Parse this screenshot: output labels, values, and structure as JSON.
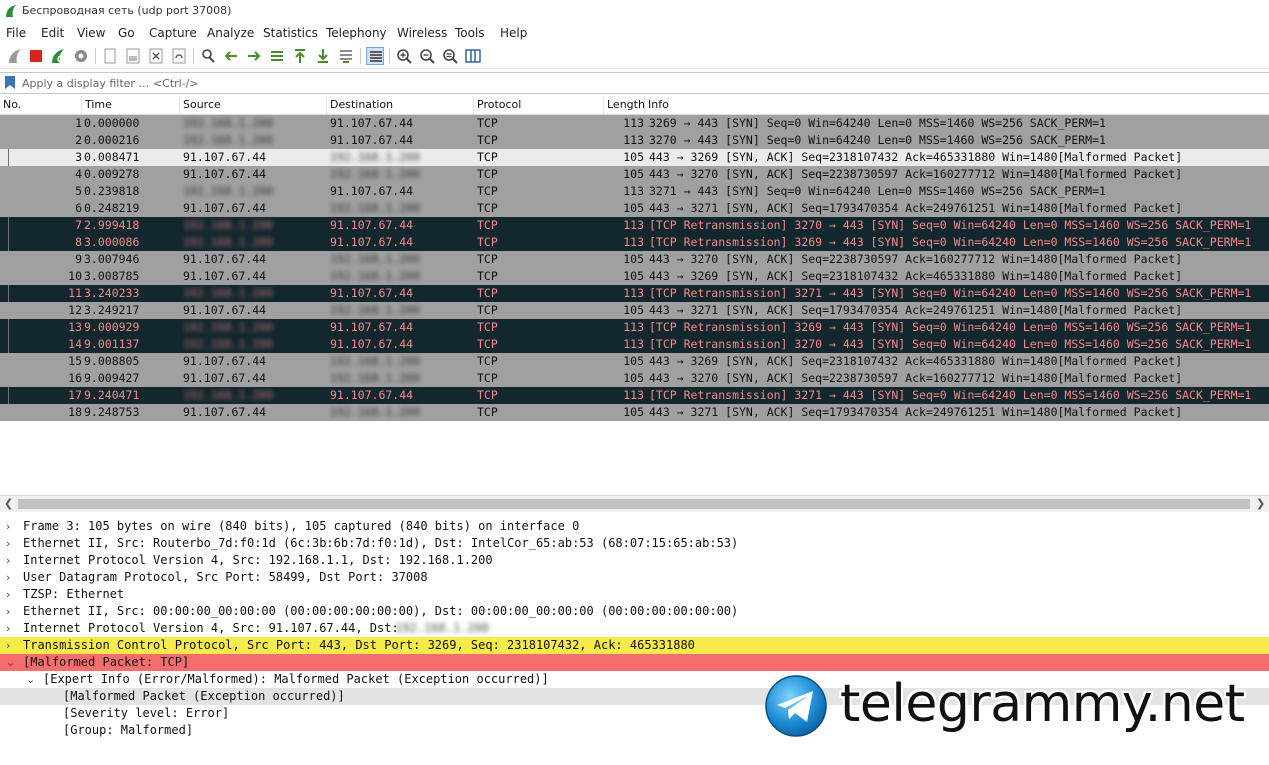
{
  "window": {
    "title": "Беспроводная сеть (udp port 37008)"
  },
  "menu": [
    "File",
    "Edit",
    "View",
    "Go",
    "Capture",
    "Analyze",
    "Statistics",
    "Telephony",
    "Wireless",
    "Tools",
    "Help"
  ],
  "filter": {
    "placeholder": "Apply a display filter … <Ctrl-/>"
  },
  "columns": [
    "No.",
    "Time",
    "Source",
    "Destination",
    "Protocol",
    "Length",
    "Info"
  ],
  "colors": {
    "dark_row": "#12272e",
    "dark_row_text": "#f78a8a",
    "gray_row": "#a0a0a0",
    "tcp_highlight": "#f6eb4a",
    "malformed_highlight": "#f76d6d"
  },
  "packets": [
    {
      "no": "1",
      "time": "0.000000",
      "src": "192.168.1.200",
      "dst": "91.107.67.44",
      "proto": "TCP",
      "len": "113",
      "info": "3269 → 443 [SYN] Seq=0 Win=64240 Len=0 MSS=1460 WS=256 SACK_PERM=1",
      "style": "g"
    },
    {
      "no": "2",
      "time": "0.000216",
      "src": "192.168.1.200",
      "dst": "91.107.67.44",
      "proto": "TCP",
      "len": "113",
      "info": "3270 → 443 [SYN] Seq=0 Win=64240 Len=0 MSS=1460 WS=256 SACK_PERM=1",
      "style": "g"
    },
    {
      "no": "3",
      "time": "0.008471",
      "src": "91.107.67.44",
      "dst": "192.168.1.200",
      "proto": "TCP",
      "len": "105",
      "info": "443 → 3269 [SYN, ACK] Seq=2318107432 Ack=465331880 Win=1480[Malformed Packet]",
      "style": "s"
    },
    {
      "no": "4",
      "time": "0.009278",
      "src": "91.107.67.44",
      "dst": "192.168.1.200",
      "proto": "TCP",
      "len": "105",
      "info": "443 → 3270 [SYN, ACK] Seq=2238730597 Ack=160277712 Win=1480[Malformed Packet]",
      "style": "g"
    },
    {
      "no": "5",
      "time": "0.239818",
      "src": "192.168.1.200",
      "dst": "91.107.67.44",
      "proto": "TCP",
      "len": "113",
      "info": "3271 → 443 [SYN] Seq=0 Win=64240 Len=0 MSS=1460 WS=256 SACK_PERM=1",
      "style": "g"
    },
    {
      "no": "6",
      "time": "0.248219",
      "src": "91.107.67.44",
      "dst": "192.168.1.200",
      "proto": "TCP",
      "len": "105",
      "info": "443 → 3271 [SYN, ACK] Seq=1793470354 Ack=249761251 Win=1480[Malformed Packet]",
      "style": "g"
    },
    {
      "no": "7",
      "time": "2.999418",
      "src": "192.168.1.200",
      "dst": "91.107.67.44",
      "proto": "TCP",
      "len": "113",
      "info": "[TCP Retransmission] 3270 → 443 [SYN] Seq=0 Win=64240 Len=0 MSS=1460 WS=256 SACK_PERM=1",
      "style": "d"
    },
    {
      "no": "8",
      "time": "3.000086",
      "src": "192.168.1.200",
      "dst": "91.107.67.44",
      "proto": "TCP",
      "len": "113",
      "info": "[TCP Retransmission] 3269 → 443 [SYN] Seq=0 Win=64240 Len=0 MSS=1460 WS=256 SACK_PERM=1",
      "style": "d"
    },
    {
      "no": "9",
      "time": "3.007946",
      "src": "91.107.67.44",
      "dst": "192.168.1.200",
      "proto": "TCP",
      "len": "105",
      "info": "443 → 3270 [SYN, ACK] Seq=2238730597 Ack=160277712 Win=1480[Malformed Packet]",
      "style": "g"
    },
    {
      "no": "10",
      "time": "3.008785",
      "src": "91.107.67.44",
      "dst": "192.168.1.200",
      "proto": "TCP",
      "len": "105",
      "info": "443 → 3269 [SYN, ACK] Seq=2318107432 Ack=465331880 Win=1480[Malformed Packet]",
      "style": "g"
    },
    {
      "no": "11",
      "time": "3.240233",
      "src": "192.168.1.200",
      "dst": "91.107.67.44",
      "proto": "TCP",
      "len": "113",
      "info": "[TCP Retransmission] 3271 → 443 [SYN] Seq=0 Win=64240 Len=0 MSS=1460 WS=256 SACK_PERM=1",
      "style": "d"
    },
    {
      "no": "12",
      "time": "3.249217",
      "src": "91.107.67.44",
      "dst": "192.168.1.200",
      "proto": "TCP",
      "len": "105",
      "info": "443 → 3271 [SYN, ACK] Seq=1793470354 Ack=249761251 Win=1480[Malformed Packet]",
      "style": "g"
    },
    {
      "no": "13",
      "time": "9.000929",
      "src": "192.168.1.200",
      "dst": "91.107.67.44",
      "proto": "TCP",
      "len": "113",
      "info": "[TCP Retransmission] 3269 → 443 [SYN] Seq=0 Win=64240 Len=0 MSS=1460 WS=256 SACK_PERM=1",
      "style": "d"
    },
    {
      "no": "14",
      "time": "9.001137",
      "src": "192.168.1.200",
      "dst": "91.107.67.44",
      "proto": "TCP",
      "len": "113",
      "info": "[TCP Retransmission] 3270 → 443 [SYN] Seq=0 Win=64240 Len=0 MSS=1460 WS=256 SACK_PERM=1",
      "style": "d"
    },
    {
      "no": "15",
      "time": "9.008805",
      "src": "91.107.67.44",
      "dst": "192.168.1.200",
      "proto": "TCP",
      "len": "105",
      "info": "443 → 3269 [SYN, ACK] Seq=2318107432 Ack=465331880 Win=1480[Malformed Packet]",
      "style": "g"
    },
    {
      "no": "16",
      "time": "9.009427",
      "src": "91.107.67.44",
      "dst": "192.168.1.200",
      "proto": "TCP",
      "len": "105",
      "info": "443 → 3270 [SYN, ACK] Seq=2238730597 Ack=160277712 Win=1480[Malformed Packet]",
      "style": "g"
    },
    {
      "no": "17",
      "time": "9.240471",
      "src": "192.168.1.200",
      "dst": "91.107.67.44",
      "proto": "TCP",
      "len": "113",
      "info": "[TCP Retransmission] 3271 → 443 [SYN] Seq=0 Win=64240 Len=0 MSS=1460 WS=256 SACK_PERM=1",
      "style": "d"
    },
    {
      "no": "18",
      "time": "9.248753",
      "src": "91.107.67.44",
      "dst": "192.168.1.200",
      "proto": "TCP",
      "len": "105",
      "info": "443 → 3271 [SYN, ACK] Seq=1793470354 Ack=249761251 Win=1480[Malformed Packet]",
      "style": "g"
    }
  ],
  "details": [
    {
      "text": "Frame 3: 105 bytes on wire (840 bits), 105 captured (840 bits) on interface 0",
      "level": 0,
      "arrow": "›",
      "style": ""
    },
    {
      "text": "Ethernet II, Src: Routerbo_7d:f0:1d (6c:3b:6b:7d:f0:1d), Dst: IntelCor_65:ab:53 (68:07:15:65:ab:53)",
      "level": 0,
      "arrow": "›",
      "style": ""
    },
    {
      "text": "Internet Protocol Version 4, Src: 192.168.1.1, Dst: 192.168.1.200",
      "level": 0,
      "arrow": "›",
      "style": ""
    },
    {
      "text": "User Datagram Protocol, Src Port: 58499, Dst Port: 37008",
      "level": 0,
      "arrow": "›",
      "style": ""
    },
    {
      "text": "TZSP: Ethernet",
      "level": 0,
      "arrow": "›",
      "style": ""
    },
    {
      "text": "Ethernet II, Src: 00:00:00_00:00:00 (00:00:00:00:00:00), Dst: 00:00:00_00:00:00 (00:00:00:00:00:00)",
      "level": 0,
      "arrow": "›",
      "style": ""
    },
    {
      "text": "Internet Protocol Version 4, Src: 91.107.67.44, Dst:",
      "level": 0,
      "arrow": "›",
      "style": "",
      "blurred_tail": "192.168.1.200"
    },
    {
      "text": "Transmission Control Protocol, Src Port: 443, Dst Port: 3269, Seq: 2318107432, Ack: 465331880",
      "level": 0,
      "arrow": "›",
      "style": "y"
    },
    {
      "text": "[Malformed Packet: TCP]",
      "level": 0,
      "arrow": "⌄",
      "style": "r"
    },
    {
      "text": "[Expert Info (Error/Malformed): Malformed Packet (Exception occurred)]",
      "level": 1,
      "arrow": "⌄",
      "style": ""
    },
    {
      "text": "[Malformed Packet (Exception occurred)]",
      "level": 2,
      "arrow": "",
      "style": "sel"
    },
    {
      "text": "[Severity level: Error]",
      "level": 2,
      "arrow": "",
      "style": ""
    },
    {
      "text": "[Group: Malformed]",
      "level": 2,
      "arrow": "",
      "style": ""
    }
  ],
  "watermark": {
    "text": "telegrammy.net",
    "icon": "telegram-logo-icon"
  }
}
